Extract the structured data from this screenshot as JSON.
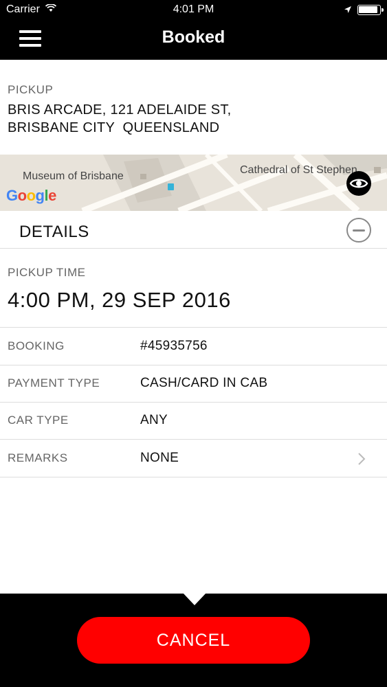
{
  "status_bar": {
    "carrier": "Carrier",
    "time": "4:01 PM"
  },
  "nav": {
    "title": "Booked"
  },
  "pickup": {
    "label": "PICKUP",
    "address_line1": "BRIS ARCADE, 121 ADELAIDE ST,",
    "address_line2": "BRISBANE CITY  QUEENSLAND"
  },
  "map": {
    "labels": {
      "museum": "Museum of Brisbane",
      "cathedral": "Cathedral of St Stephen"
    },
    "attribution": "Google"
  },
  "details": {
    "title": "DETAILS",
    "pickup_time_label": "PICKUP TIME",
    "pickup_time_value": "4:00 PM, 29 SEP 2016",
    "rows": [
      {
        "label": "BOOKING",
        "value": "#45935756"
      },
      {
        "label": "PAYMENT TYPE",
        "value": "CASH/CARD IN CAB"
      },
      {
        "label": "CAR TYPE",
        "value": "ANY"
      },
      {
        "label": "REMARKS",
        "value": "NONE"
      }
    ]
  },
  "actions": {
    "cancel_label": "CANCEL"
  },
  "colors": {
    "header_bg": "#000000",
    "cancel_button": "#ff0000",
    "label_text": "#666666",
    "value_text": "#111111"
  },
  "icons": [
    "wifi-icon",
    "location-arrow-icon",
    "battery-icon",
    "menu-icon",
    "eye-icon",
    "collapse-minus-icon",
    "chevron-right-icon"
  ]
}
